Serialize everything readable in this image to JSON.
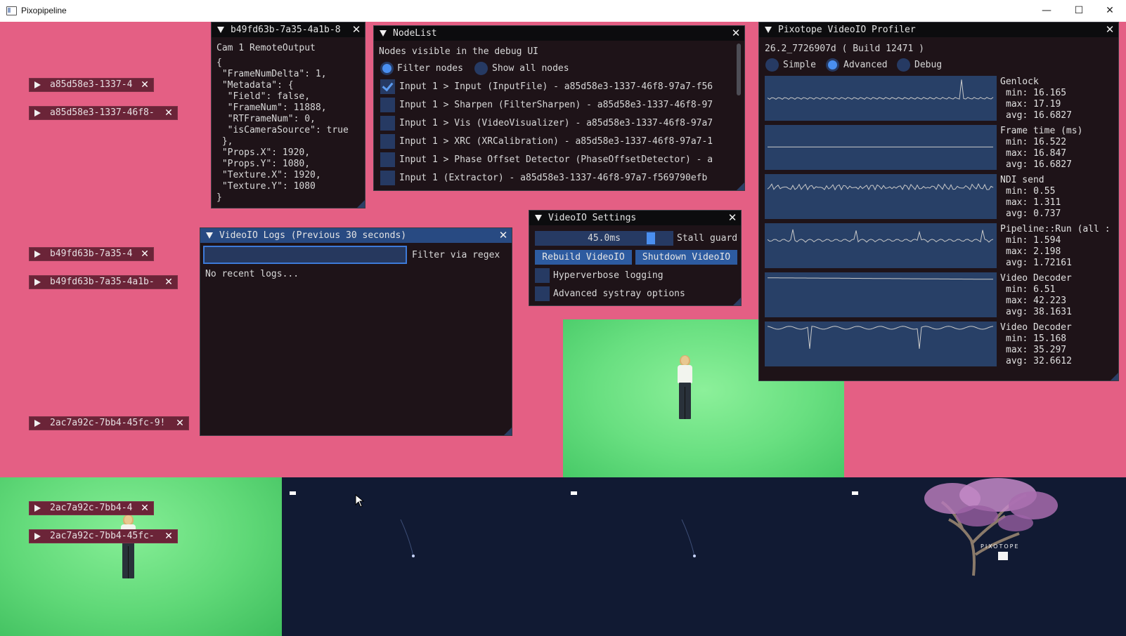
{
  "window": {
    "title": "Pixopipeline",
    "minimize": "—",
    "maximize": "☐",
    "close": "✕"
  },
  "node_buttons": [
    {
      "label": "a85d58e3-1337-4",
      "close": "✕"
    },
    {
      "label": "a85d58e3-1337-46f8-",
      "close": "✕"
    },
    {
      "label": "b49fd63b-7a35-4",
      "close": "✕"
    },
    {
      "label": "b49fd63b-7a35-4a1b-",
      "close": "✕"
    },
    {
      "label": "2ac7a92c-7bb4-45fc-9!",
      "close": "✕"
    },
    {
      "label": "2ac7a92c-7bb4-4",
      "close": "✕"
    },
    {
      "label": "2ac7a92c-7bb4-45fc-",
      "close": "✕"
    }
  ],
  "remote_output": {
    "title": "b49fd63b-7a35-4a1b-8",
    "close": "✕",
    "heading": "Cam 1 RemoteOutput",
    "json_lines": [
      "{",
      " \"FrameNumDelta\": 1,",
      " \"Metadata\": {",
      "  \"Field\": false,",
      "  \"FrameNum\": 11888,",
      "  \"RTFrameNum\": 0,",
      "  \"isCameraSource\": true",
      " },",
      " \"Props.X\": 1920,",
      " \"Props.Y\": 1080,",
      " \"Texture.X\": 1920,",
      " \"Texture.Y\": 1080",
      "}"
    ]
  },
  "node_list": {
    "title": "NodeList",
    "close": "✕",
    "description": "Nodes visible in the debug UI",
    "filter_label": "Filter nodes",
    "show_all_label": "Show all nodes",
    "filter_selected": true,
    "items": [
      {
        "label": "Input 1 > Input (InputFile) - a85d58e3-1337-46f8-97a7-f56",
        "checked": true
      },
      {
        "label": "Input 1 > Sharpen (FilterSharpen) - a85d58e3-1337-46f8-97",
        "checked": false
      },
      {
        "label": "Input 1 > Vis (VideoVisualizer) - a85d58e3-1337-46f8-97a7",
        "checked": false
      },
      {
        "label": "Input 1 > XRC (XRCalibration) - a85d58e3-1337-46f8-97a7-1",
        "checked": false
      },
      {
        "label": "Input 1 > Phase Offset Detector (PhaseOffsetDetector) - a",
        "checked": false
      },
      {
        "label": "Input 1 (Extractor) - a85d58e3-1337-46f8-97a7-f569790efb",
        "checked": false
      }
    ]
  },
  "logs": {
    "title": "VideoIO Logs (Previous 30 seconds)",
    "close": "✕",
    "filter_value": "",
    "filter_label": "Filter via regex",
    "empty_message": "No recent logs..."
  },
  "videoio_settings": {
    "title": "VideoIO Settings",
    "close": "✕",
    "stall_value": "45.0ms",
    "stall_label": "Stall guard",
    "stall_fraction": 0.86,
    "rebuild_label": "Rebuild VideoIO",
    "shutdown_label": "Shutdown VideoIO",
    "hyperverbose_label": "Hyperverbose logging",
    "systray_label": "Advanced systray options",
    "hyperverbose_checked": false,
    "systray_checked": false
  },
  "profiler": {
    "title": "Pixotope VideoIO Profiler",
    "close": "✕",
    "version": "26.2_7726907d ( Build 12471 )",
    "modes": [
      "Simple",
      "Advanced",
      "Debug"
    ],
    "selected_mode": "Advanced",
    "metrics": [
      {
        "name": "Genlock",
        "min": "min: 16.165",
        "max": "max: 17.19",
        "avg": "avg: 16.6827"
      },
      {
        "name": "Frame time (ms)",
        "min": "min: 16.522",
        "max": "max: 16.847",
        "avg": "avg: 16.6827"
      },
      {
        "name": "NDI send",
        "min": "min: 0.55",
        "max": "max: 1.311",
        "avg": "avg: 0.737"
      },
      {
        "name": "Pipeline::Run (all :",
        "min": "min: 1.594",
        "max": "max: 2.198",
        "avg": "avg: 1.72161"
      },
      {
        "name": "Video Decoder",
        "min": "min: 6.51",
        "max": "max: 42.223",
        "avg": "avg: 38.1631"
      },
      {
        "name": "Video Decoder",
        "min": "min: 15.168",
        "max": "max: 35.297",
        "avg": "avg: 32.6612"
      }
    ]
  },
  "watermark": "PIXOTOPE",
  "colors": {
    "background": "#e45f84",
    "panel_bg": "#1e1318",
    "title_bg": "#0c0c0e",
    "active_title_bg": "#284a82",
    "accent": "#4a8ff0",
    "button": "#2d5ba0",
    "graph_bg": "#284067"
  }
}
